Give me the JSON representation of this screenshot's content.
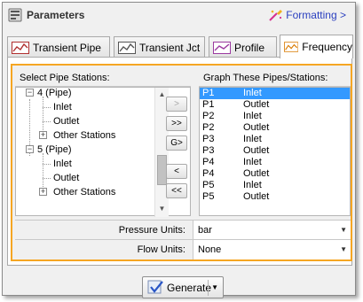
{
  "window": {
    "title": "Parameters",
    "formatting_label": "Formatting >"
  },
  "tabs": [
    {
      "label": "Transient Pipe",
      "icon": "transient-pipe-icon",
      "active": false
    },
    {
      "label": "Transient Jct",
      "icon": "transient-jct-icon",
      "active": false
    },
    {
      "label": "Profile",
      "icon": "profile-icon",
      "active": false
    },
    {
      "label": "Frequency",
      "icon": "frequency-icon",
      "active": true
    }
  ],
  "select_stations": {
    "header": "Select Pipe Stations:",
    "tree": [
      {
        "label": "4 (Pipe)",
        "kind": "pipe",
        "expanded": true
      },
      {
        "label": "Inlet",
        "kind": "station"
      },
      {
        "label": "Outlet",
        "kind": "station"
      },
      {
        "label": "Other Stations",
        "kind": "group",
        "expanded": false
      },
      {
        "label": "5 (Pipe)",
        "kind": "pipe",
        "expanded": true
      },
      {
        "label": "Inlet",
        "kind": "station"
      },
      {
        "label": "Outlet",
        "kind": "station"
      },
      {
        "label": "Other Stations",
        "kind": "group",
        "expanded": false
      }
    ]
  },
  "transfer_buttons": {
    "add": ">",
    "add_all": ">>",
    "add_group": "G>",
    "remove": "<",
    "remove_all": "<<"
  },
  "graph_stations": {
    "header": "Graph These Pipes/Stations:",
    "rows": [
      {
        "pipe": "P1",
        "station": "Inlet",
        "selected": true
      },
      {
        "pipe": "P1",
        "station": "Outlet",
        "selected": false
      },
      {
        "pipe": "P2",
        "station": "Inlet",
        "selected": false
      },
      {
        "pipe": "P2",
        "station": "Outlet",
        "selected": false
      },
      {
        "pipe": "P3",
        "station": "Inlet",
        "selected": false
      },
      {
        "pipe": "P3",
        "station": "Outlet",
        "selected": false
      },
      {
        "pipe": "P4",
        "station": "Inlet",
        "selected": false
      },
      {
        "pipe": "P4",
        "station": "Outlet",
        "selected": false
      },
      {
        "pipe": "P5",
        "station": "Inlet",
        "selected": false
      },
      {
        "pipe": "P5",
        "station": "Outlet",
        "selected": false
      }
    ]
  },
  "units": {
    "pressure_label": "Pressure Units:",
    "pressure_value": "bar",
    "flow_label": "Flow Units:",
    "flow_value": "None"
  },
  "generate": {
    "label": "Generate"
  },
  "colors": {
    "highlight": "#f5a623",
    "selection": "#3399ff",
    "link": "#2a3fbf"
  }
}
